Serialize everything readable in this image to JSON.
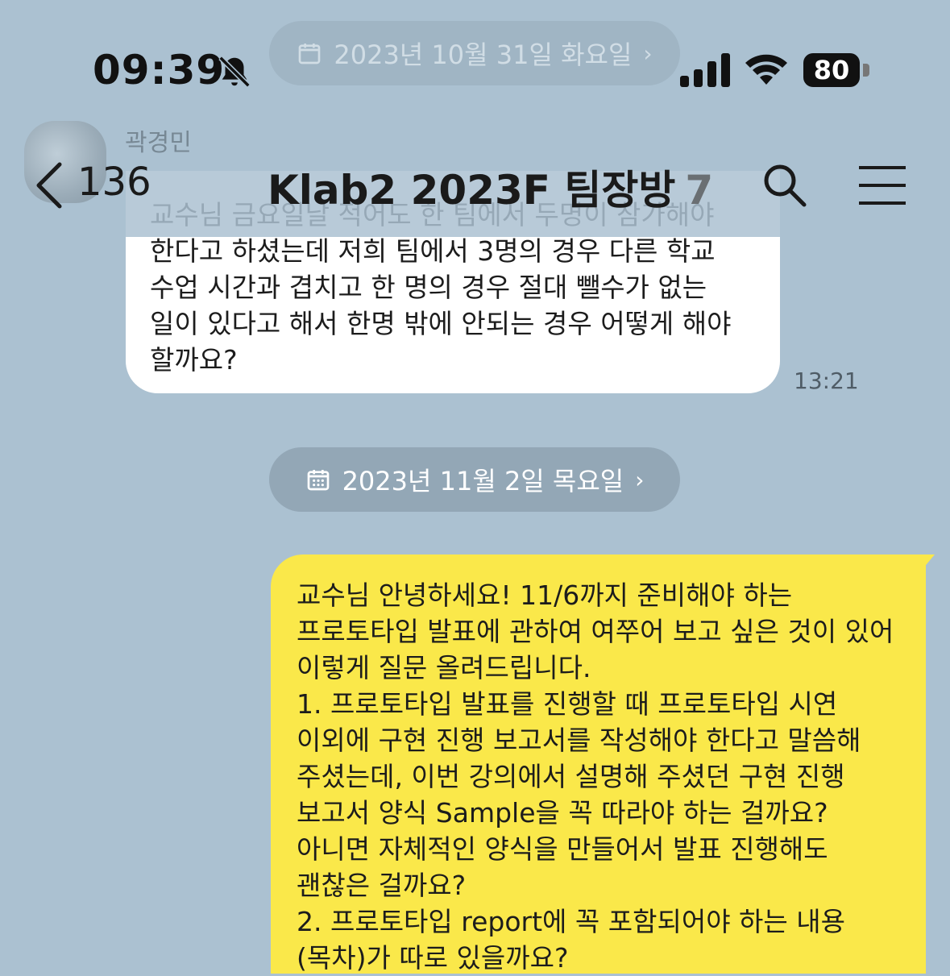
{
  "status_bar": {
    "time": "09:39",
    "battery": "80"
  },
  "header": {
    "back_count": "136",
    "title": "Klab2 2023F 팀장방",
    "member_count": "7"
  },
  "date_separators": {
    "top": "2023년 10월 31일 화요일",
    "middle": "2023년 11월 2일 목요일"
  },
  "incoming": {
    "sender": "곽경민",
    "text": "교수님 금요일날 적어도 한 팀에서 두명이 참가해야 한다고 하셨는데 저희 팀에서 3명의 경우 다른 학교 수업 시간과 겹치고 한 명의 경우 절대 뺄수가 없는 일이 있다고 해서 한명 밖에 안되는 경우 어떻게 해야 할까요?",
    "time": "13:21"
  },
  "outgoing": {
    "text": "교수님 안녕하세요! 11/6까지 준비해야 하는 프로토타입 발표에 관하여 여쭈어 보고 싶은 것이 있어 이렇게 질문 올려드립니다.\n1. 프로토타입 발표를 진행할 때 프로토타입 시연 이외에 구현 진행 보고서를 작성해야 한다고 말씀해 주셨는데, 이번 강의에서 설명해 주셨던 구현 진행 보고서 양식 Sample을 꼭 따라야 하는 걸까요? 아니면 자체적인 양식을 만들어서 발표 진행해도 괜찮은 걸까요?\n2. 프로토타입 report에 꼭 포함되어야 하는 내용(목차)가 따로 있을까요?"
  },
  "colors": {
    "background": "#abc1d1",
    "incoming_bubble": "#ffffff",
    "outgoing_bubble": "#fae84a",
    "date_pill": "#93a7b6"
  },
  "icons": [
    "bell-slash-icon",
    "signal-icon",
    "wifi-icon",
    "back-chevron-icon",
    "search-icon",
    "menu-icon",
    "calendar-icon",
    "chevron-right-icon"
  ]
}
